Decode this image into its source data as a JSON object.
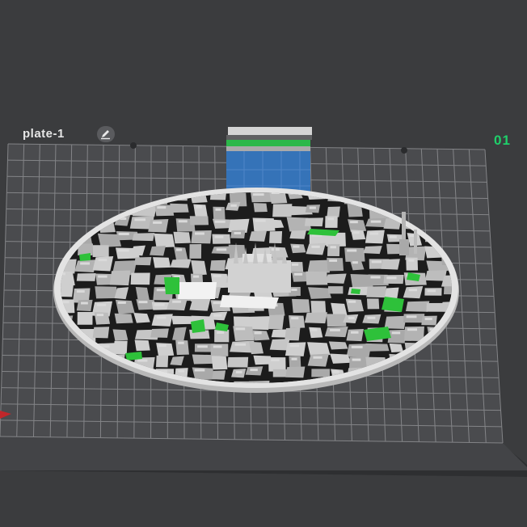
{
  "plate": {
    "name": "plate-1",
    "index": "01",
    "edit_icon": "edit-pencil-icon"
  },
  "colors": {
    "background": "#3b3c3e",
    "bed": "#4a4b4e",
    "grid_line": "#8a8b8e",
    "model_base": "#dcdcdc",
    "buildings": "#b9b9b9",
    "streets": "#1c1c1c",
    "parks": "#2ec13a",
    "purge_tower_blue": "#3573b8",
    "purge_tower_green": "#2cb84a",
    "accent": "#1fcf6a"
  }
}
